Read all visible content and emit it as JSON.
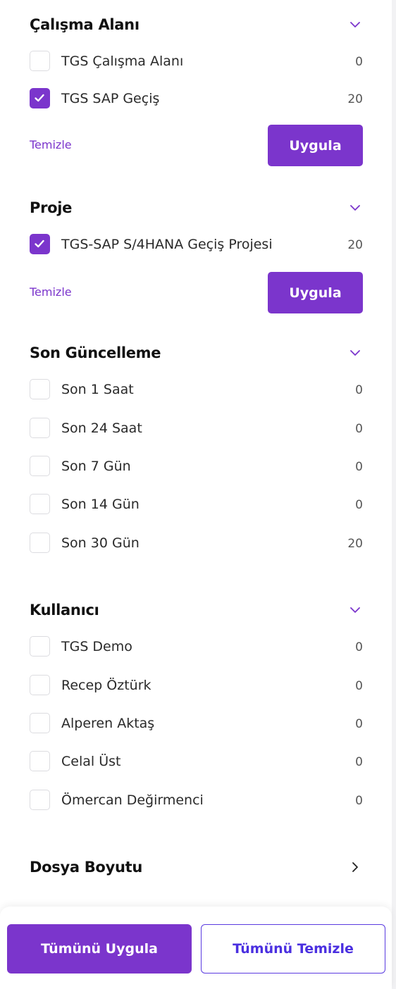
{
  "colors": {
    "accent": "#7b35cc",
    "secondary_text": "#4a2fe0"
  },
  "sections": {
    "workspace": {
      "title": "Çalışma Alanı",
      "icon": "chevron-down-icon",
      "options": [
        {
          "label": "TGS Çalışma Alanı",
          "count": "0",
          "checked": false
        },
        {
          "label": "TGS SAP Geçiş",
          "count": "20",
          "checked": true
        }
      ],
      "clear_label": "Temizle",
      "apply_label": "Uygula"
    },
    "project": {
      "title": "Proje",
      "icon": "chevron-down-icon",
      "options": [
        {
          "label": "TGS-SAP S/4HANA Geçiş Projesi",
          "count": "20",
          "checked": true
        }
      ],
      "clear_label": "Temizle",
      "apply_label": "Uygula"
    },
    "last_update": {
      "title": "Son Güncelleme",
      "icon": "chevron-down-icon",
      "options": [
        {
          "label": "Son 1 Saat",
          "count": "0",
          "checked": false
        },
        {
          "label": "Son 24 Saat",
          "count": "0",
          "checked": false
        },
        {
          "label": "Son 7 Gün",
          "count": "0",
          "checked": false
        },
        {
          "label": "Son 14 Gün",
          "count": "0",
          "checked": false
        },
        {
          "label": "Son 30 Gün",
          "count": "20",
          "checked": false
        }
      ]
    },
    "user": {
      "title": "Kullanıcı",
      "icon": "chevron-down-icon",
      "options": [
        {
          "label": "TGS Demo",
          "count": "0",
          "checked": false
        },
        {
          "label": "Recep Öztürk",
          "count": "0",
          "checked": false
        },
        {
          "label": "Alperen Aktaş",
          "count": "0",
          "checked": false
        },
        {
          "label": "Celal Üst",
          "count": "0",
          "checked": false
        },
        {
          "label": "Ömercan Değirmenci",
          "count": "0",
          "checked": false
        }
      ]
    },
    "file_size": {
      "title": "Dosya Boyutu",
      "icon": "chevron-right-icon"
    }
  },
  "footer": {
    "apply_all_label": "Tümünü Uygula",
    "clear_all_label": "Tümünü Temizle"
  }
}
